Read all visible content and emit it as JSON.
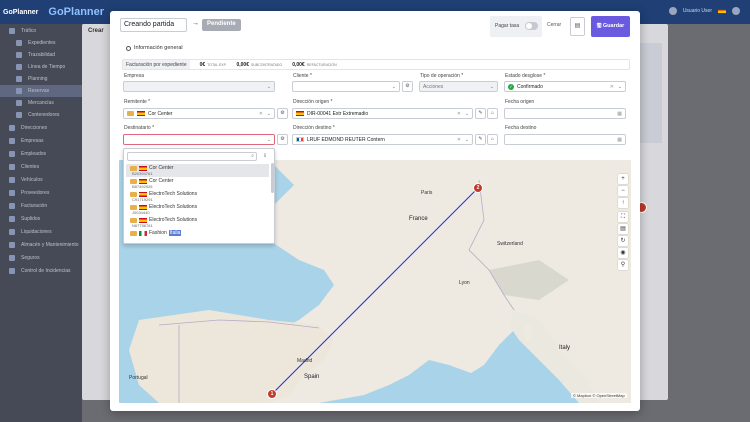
{
  "app": {
    "brand_small": "GoPlanner",
    "brand_large": "GoPlanner",
    "user": "Usuario User",
    "sidebar": [
      {
        "label": "Tráfico",
        "sub": false
      },
      {
        "label": "Expedientes",
        "sub": true
      },
      {
        "label": "Trazabilidad",
        "sub": true
      },
      {
        "label": "Línea de Tiempo",
        "sub": true
      },
      {
        "label": "Planning",
        "sub": true
      },
      {
        "label": "Reservas",
        "sub": true,
        "active": true
      },
      {
        "label": "Mercancías",
        "sub": true
      },
      {
        "label": "Contenedores",
        "sub": true
      },
      {
        "label": "Direcciones",
        "sub": false
      },
      {
        "label": "Empresas",
        "sub": false
      },
      {
        "label": "Empleados",
        "sub": false
      },
      {
        "label": "Clientes",
        "sub": false
      },
      {
        "label": "Vehículos",
        "sub": false
      },
      {
        "label": "Proveedores",
        "sub": false
      },
      {
        "label": "Facturación",
        "sub": false
      },
      {
        "label": "Suplidos",
        "sub": false
      },
      {
        "label": "Liquidaciones",
        "sub": false
      },
      {
        "label": "Almacén y Mantenimiento",
        "sub": false
      },
      {
        "label": "Seguros",
        "sub": false
      },
      {
        "label": "Control de Incidencias",
        "sub": false
      }
    ],
    "bg_modal_title": "Crear"
  },
  "header": {
    "title_value": "Creando partida",
    "arrow": "→",
    "status": "Pendiente",
    "pay_label": "Pagar tasa",
    "close_label": "Cerrar",
    "save_label": "Guardar"
  },
  "section_title": "Información general",
  "billing": {
    "label": "Facturación por expediente",
    "items": [
      {
        "value": "0€",
        "label": "TOTAL EXP."
      },
      {
        "value": "0,00€",
        "label": "SUBCONTRATADO"
      },
      {
        "value": "0,00€",
        "label": "REFACTURACIÓN"
      }
    ]
  },
  "fields": {
    "empresa_label": "Empresa",
    "cliente_label": "Cliente *",
    "tipo_label": "Tipo de operación *",
    "tipo_value": "Acciones",
    "estado_label": "Estado desglose *",
    "estado_value": "Confirmado",
    "remitente_label": "Remitente *",
    "remitente_value": "Cor Center",
    "dir_origen_label": "Dirección origen *",
    "dir_origen_value": "DIR-00041 Extr Extremadio",
    "fecha_origen_label": "Fecha origen",
    "destinatario_label": "Destinatario *",
    "dir_destino_label": "Dirección destino *",
    "dir_destino_value": "LRUF EDMOND REUTER Contern",
    "fecha_destino_label": "Fecha destino"
  },
  "dropdown": {
    "items": [
      {
        "name": "Cor Center",
        "code": "B20394761",
        "selected": true,
        "flag": "es"
      },
      {
        "name": "Cor Center",
        "code": "B87492926",
        "selected": false,
        "flag": "es"
      },
      {
        "name": "ElectroTech Solutions",
        "code": "C91719291",
        "selected": false,
        "flag": "es"
      },
      {
        "name": "ElectroTech Solutions",
        "code": "J0034440",
        "selected": false,
        "flag": "es"
      },
      {
        "name": "ElectroTech Solutions",
        "code": "N67756761",
        "selected": false,
        "flag": "es"
      },
      {
        "name_prefix": "Fashion ",
        "name_highlight": "Italia",
        "code": "",
        "selected": false,
        "flag": "it"
      }
    ]
  },
  "map": {
    "labels": [
      "France",
      "Paris",
      "Spain",
      "Switzerland",
      "Italy",
      "Portugal",
      "Lyon",
      "Madrid"
    ],
    "attribution": "© Mapbox © OpenStreetMap",
    "marker_start": "1",
    "marker_end": "2",
    "route_color": "#2a2ad6"
  },
  "colors": {
    "accent": "#6a5ae0",
    "marker": "#c0392b",
    "status_pill": "#a7abb4"
  }
}
